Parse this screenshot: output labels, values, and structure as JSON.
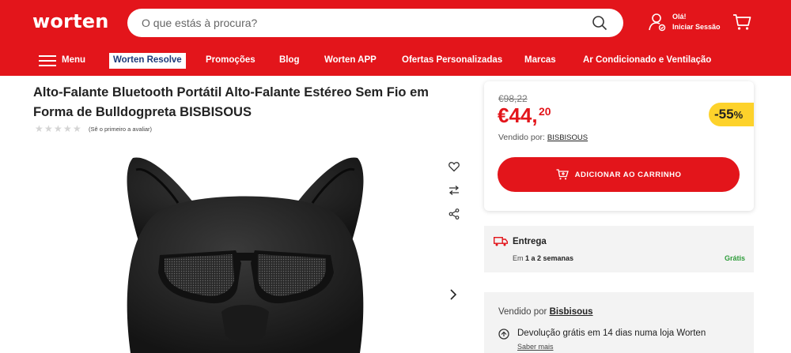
{
  "header": {
    "logo": "worten",
    "search_placeholder": "O que estás à procura?",
    "user_greeting": "Olá!",
    "user_login": "Iniciar Sessão"
  },
  "nav": {
    "menu_label": "Menu",
    "items": [
      "Worten Resolve",
      "Promoções",
      "Blog",
      "Worten APP",
      "Ofertas Personalizadas",
      "Marcas",
      "Ar Condicionado e Ventilação"
    ]
  },
  "product": {
    "title": "Alto-Falante Bluetooth Portátil Alto-Falante Estéreo Sem Fio em Forma de Bulldogpreta BISBISOUS",
    "rating_text": "(Sê o primeiro a avaliar)",
    "rating_stars": 0
  },
  "price_card": {
    "old_price": "€98,22",
    "price": "€44,",
    "cents": "20",
    "discount_value": "-55",
    "discount_unit": "%",
    "sold_by_label": "Vendido por:",
    "seller": "BISBISOUS",
    "add_to_cart": "ADICIONAR AO CARRINHO"
  },
  "delivery": {
    "title": "Entrega",
    "time_prefix": "Em",
    "time_value": "1 a 2 semanas",
    "cost": "Grátis"
  },
  "seller_info": {
    "sold_by_label": "Vendido por",
    "seller": "Bisbisous",
    "returns": "Devolução grátis em 14 dias numa loja Worten",
    "know_more": "Saber mais"
  },
  "colors": {
    "brand": "#e3151b",
    "discount": "#fdd22b",
    "free": "#2e9c3a"
  }
}
